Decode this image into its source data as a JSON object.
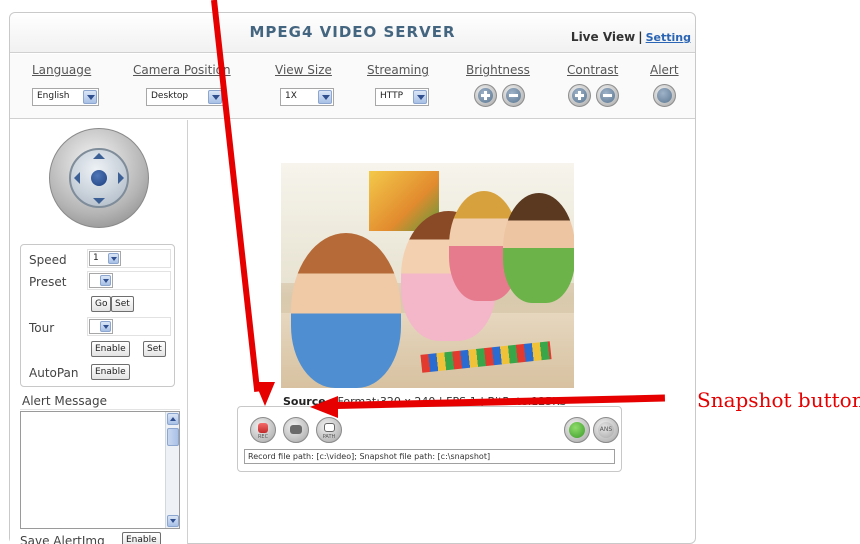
{
  "header": {
    "app_title": "MPEG4 VIDEO SERVER",
    "live_view": "Live View",
    "separator": "|",
    "setting": "Setting"
  },
  "toolbar": {
    "language": {
      "label": "Language",
      "value": "English"
    },
    "camera_position": {
      "label": "Camera Position",
      "value": "Desktop"
    },
    "view_size": {
      "label": "View Size",
      "value": "1X"
    },
    "streaming": {
      "label": "Streaming",
      "value": "HTTP"
    },
    "brightness": {
      "label": "Brightness"
    },
    "contrast": {
      "label": "Contrast"
    },
    "alert": {
      "label": "Alert"
    }
  },
  "ptz": {
    "speed_label": "Speed",
    "speed_value": "1",
    "preset_label": "Preset",
    "preset_value": "",
    "go_label": "Go",
    "set_label": "Set",
    "tour_label": "Tour",
    "tour_value": "",
    "enable_label": "Enable",
    "autopan_label": "AutoPan"
  },
  "alert": {
    "title": "Alert Message",
    "save_label": "Save AlertImg",
    "enable_label": "Enable"
  },
  "video": {
    "source_label": "Source :",
    "source_info": "Format:320 x 240 | FPS:1 | BitRate:125Kb"
  },
  "recorder": {
    "rec_caption": "REC",
    "path_caption": "PATH",
    "ans_caption": "ANS",
    "path_text": "Record file path: [c:\\video]; Snapshot file path: [c:\\snapshot]"
  },
  "annotation": {
    "text": "Snapshot button",
    "color": "#e60000"
  }
}
